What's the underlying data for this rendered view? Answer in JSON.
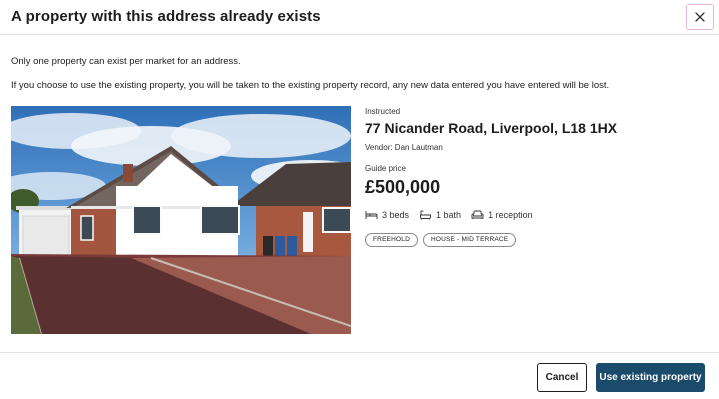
{
  "modal": {
    "title": "A property with this address already exists",
    "close_icon": "close-icon"
  },
  "messages": {
    "line1": "Only one property can exist per market for an address.",
    "line2": "If you choose to use the existing property, you will be taken to the existing property record, any new data entered you have entered will be lost."
  },
  "property": {
    "status": "Instructed",
    "address": "77 Nicander Road, Liverpool, L18 1HX",
    "vendor": "Vendor: Dan Lautman",
    "price_label": "Guide price",
    "price": "£500,000",
    "beds": "3 beds",
    "baths": "1 bath",
    "receptions": "1 reception",
    "tags": [
      "FREEHOLD",
      "HOUSE - MID TERRACE"
    ]
  },
  "footer": {
    "cancel_label": "Cancel",
    "primary_label": "Use existing property"
  },
  "colors": {
    "primary_button": "#1b4b6b",
    "close_button_border": "#e8b2e3"
  }
}
